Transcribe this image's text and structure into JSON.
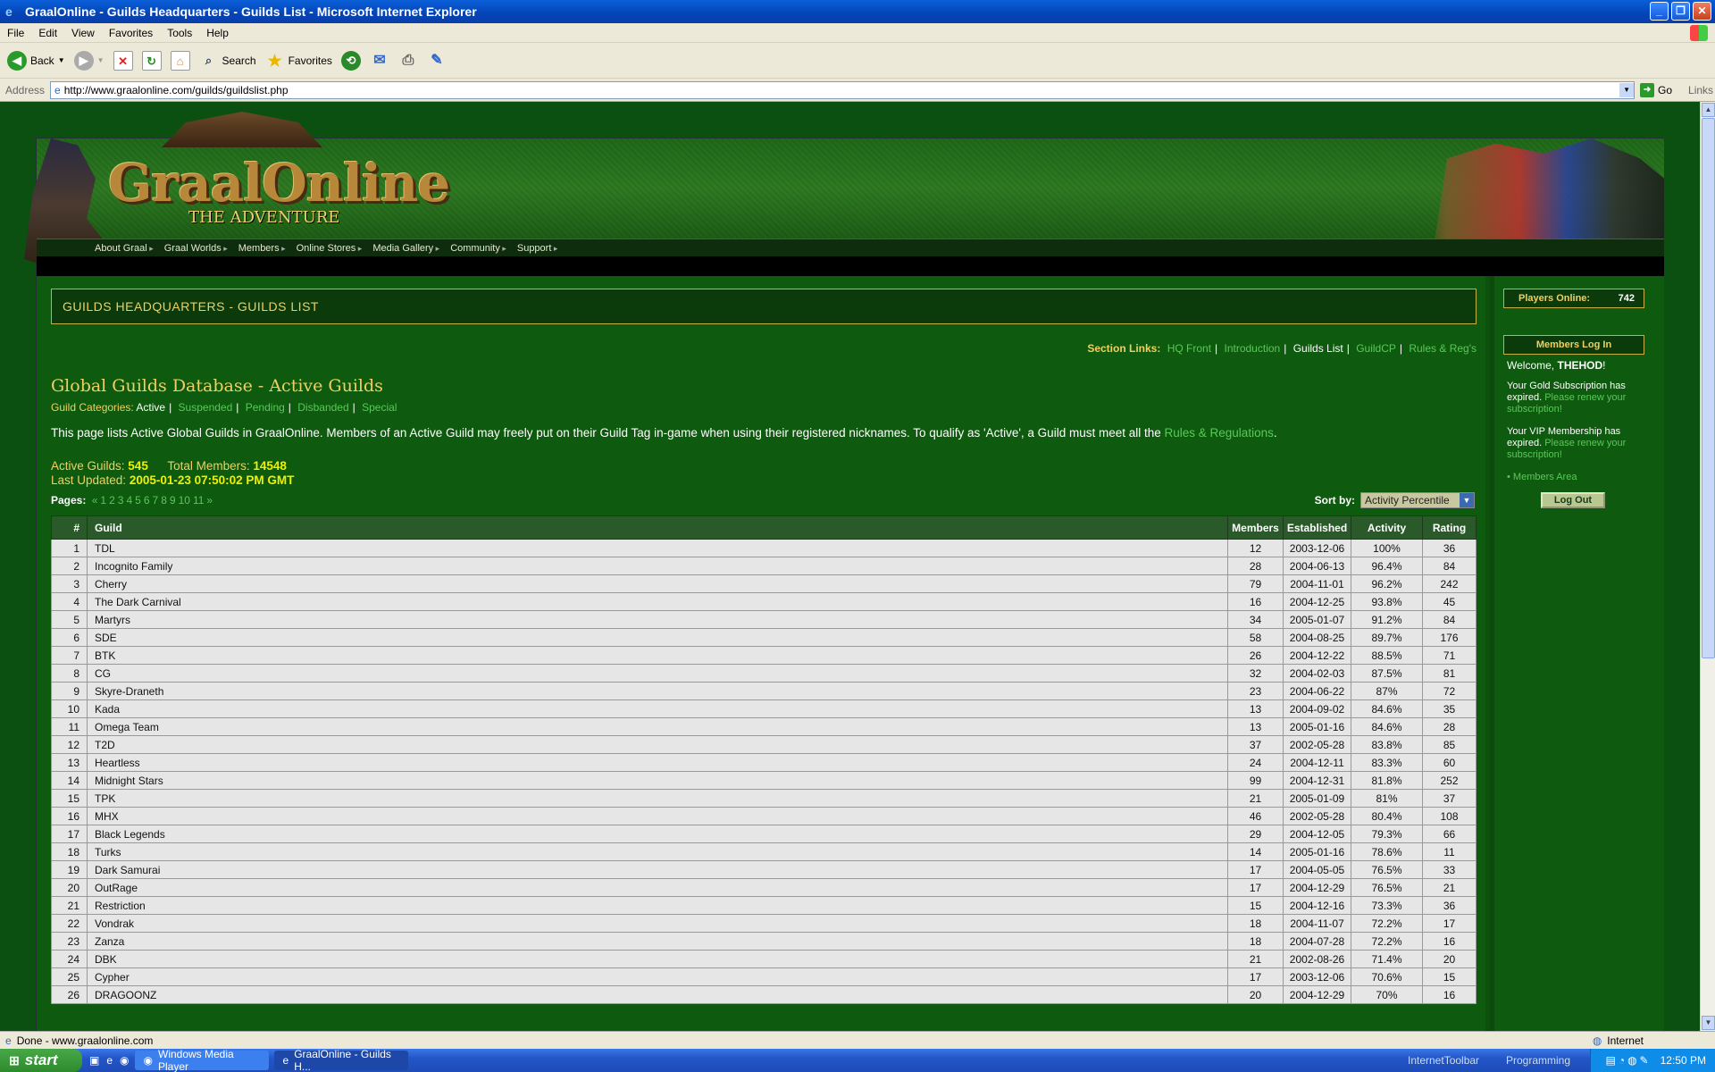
{
  "window": {
    "title": "GraalOnline - Guilds Headquarters - Guilds List - Microsoft Internet Explorer"
  },
  "menu": [
    "File",
    "Edit",
    "View",
    "Favorites",
    "Tools",
    "Help"
  ],
  "toolbar": {
    "back": "Back",
    "search": "Search",
    "favorites": "Favorites"
  },
  "address": {
    "label": "Address",
    "url": "http://www.graalonline.com/guilds/guildslist.php",
    "go": "Go",
    "links": "Links"
  },
  "site": {
    "logo": "GraalOnline",
    "logo_sub": "THE ADVENTURE",
    "nav": [
      "About Graal",
      "Graal Worlds",
      "Members",
      "Online Stores",
      "Media Gallery",
      "Community",
      "Support"
    ]
  },
  "main": {
    "heading": "GUILDS HEADQUARTERS - GUILDS LIST",
    "section_links_label": "Section Links:",
    "section_links": [
      {
        "label": "HQ Front",
        "active": false
      },
      {
        "label": "Introduction",
        "active": false
      },
      {
        "label": "Guilds List",
        "active": true
      },
      {
        "label": "GuildCP",
        "active": false
      },
      {
        "label": "Rules & Reg's",
        "active": false
      }
    ],
    "db_title": "Global Guilds Database - Active Guilds",
    "categories_label": "Guild Categories:",
    "categories": [
      {
        "label": "Active",
        "active": true
      },
      {
        "label": "Suspended",
        "active": false
      },
      {
        "label": "Pending",
        "active": false
      },
      {
        "label": "Disbanded",
        "active": false
      },
      {
        "label": "Special",
        "active": false
      }
    ],
    "description": "This page lists Active Global Guilds in GraalOnline. Members of an Active Guild may freely put on their Guild Tag in-game when using their registered nicknames. To qualify as 'Active', a Guild must meet all the",
    "description_link": "Rules & Regulations",
    "description_end": ".",
    "active_guilds_label": "Active Guilds:",
    "active_guilds": "545",
    "total_members_label": "Total Members:",
    "total_members": "14548",
    "last_updated_label": "Last Updated:",
    "last_updated": "2005-01-23 07:50:02 PM GMT",
    "pages_label": "Pages:",
    "pages": [
      "«",
      "1",
      "2",
      "3",
      "4",
      "5",
      "6",
      "7",
      "8",
      "9",
      "10",
      "11",
      "»"
    ],
    "sort_label": "Sort by:",
    "sort_value": "Activity Percentile",
    "columns": [
      "#",
      "Guild",
      "Members",
      "Established",
      "Activity",
      "Rating"
    ],
    "rows": [
      [
        "1",
        "TDL",
        "12",
        "2003-12-06",
        "100%",
        "36"
      ],
      [
        "2",
        "Incognito Family",
        "28",
        "2004-06-13",
        "96.4%",
        "84"
      ],
      [
        "3",
        "Cherry",
        "79",
        "2004-11-01",
        "96.2%",
        "242"
      ],
      [
        "4",
        "The Dark Carnival",
        "16",
        "2004-12-25",
        "93.8%",
        "45"
      ],
      [
        "5",
        "Martyrs",
        "34",
        "2005-01-07",
        "91.2%",
        "84"
      ],
      [
        "6",
        "SDE",
        "58",
        "2004-08-25",
        "89.7%",
        "176"
      ],
      [
        "7",
        "BTK",
        "26",
        "2004-12-22",
        "88.5%",
        "71"
      ],
      [
        "8",
        "CG",
        "32",
        "2004-02-03",
        "87.5%",
        "81"
      ],
      [
        "9",
        "Skyre-Draneth",
        "23",
        "2004-06-22",
        "87%",
        "72"
      ],
      [
        "10",
        "Kada",
        "13",
        "2004-09-02",
        "84.6%",
        "35"
      ],
      [
        "11",
        "Omega Team",
        "13",
        "2005-01-16",
        "84.6%",
        "28"
      ],
      [
        "12",
        "T2D",
        "37",
        "2002-05-28",
        "83.8%",
        "85"
      ],
      [
        "13",
        "Heartless",
        "24",
        "2004-12-11",
        "83.3%",
        "60"
      ],
      [
        "14",
        "Midnight Stars",
        "99",
        "2004-12-31",
        "81.8%",
        "252"
      ],
      [
        "15",
        "TPK",
        "21",
        "2005-01-09",
        "81%",
        "37"
      ],
      [
        "16",
        "MHX",
        "46",
        "2002-05-28",
        "80.4%",
        "108"
      ],
      [
        "17",
        "Black Legends",
        "29",
        "2004-12-05",
        "79.3%",
        "66"
      ],
      [
        "18",
        "Turks",
        "14",
        "2005-01-16",
        "78.6%",
        "11"
      ],
      [
        "19",
        "Dark Samurai",
        "17",
        "2004-05-05",
        "76.5%",
        "33"
      ],
      [
        "20",
        "OutRage",
        "17",
        "2004-12-29",
        "76.5%",
        "21"
      ],
      [
        "21",
        "Restriction",
        "15",
        "2004-12-16",
        "73.3%",
        "36"
      ],
      [
        "22",
        "Vondrak",
        "18",
        "2004-11-07",
        "72.2%",
        "17"
      ],
      [
        "23",
        "Zanza",
        "18",
        "2004-07-28",
        "72.2%",
        "16"
      ],
      [
        "24",
        "DBK",
        "21",
        "2002-08-26",
        "71.4%",
        "20"
      ],
      [
        "25",
        "Cypher",
        "17",
        "2003-12-06",
        "70.6%",
        "15"
      ],
      [
        "26",
        "DRAGOONZ",
        "20",
        "2004-12-29",
        "70%",
        "16"
      ]
    ]
  },
  "sidebar": {
    "players_online_label": "Players Online:",
    "players_online": "742",
    "members_login": "Members Log In",
    "welcome": "Welcome,",
    "username": "THEHOD",
    "welcome_end": "!",
    "gold_text": "Your Gold Subscription has expired.",
    "gold_link": "Please renew your subscription!",
    "vip_text": "Your VIP Membership has expired.",
    "vip_link": "Please renew your subscription!",
    "members_area": "Members Area",
    "logout": "Log Out"
  },
  "status": {
    "text": "Done - www.graalonline.com",
    "zone": "Internet"
  },
  "taskbar": {
    "start": "start",
    "tasks": [
      "Windows Media Player",
      "GraalOnline - Guilds H..."
    ],
    "toolbars": [
      "InternetToolbar",
      "Programming"
    ],
    "clock": "12:50 PM"
  }
}
